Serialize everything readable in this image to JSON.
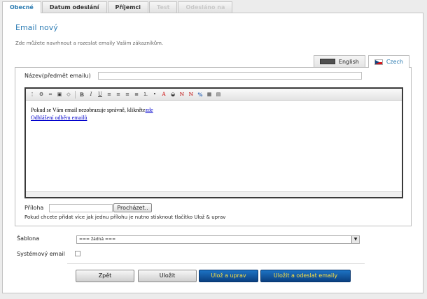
{
  "top_tabs": [
    {
      "label": "Obecné",
      "state": "active"
    },
    {
      "label": "Datum odeslání",
      "state": "normal"
    },
    {
      "label": "Příjemci",
      "state": "normal"
    },
    {
      "label": "Test",
      "state": "disabled"
    },
    {
      "label": "Odesláno na",
      "state": "disabled"
    }
  ],
  "page": {
    "title": "Email nový",
    "description": "Zde můžete navrhnout a rozeslat emaily Vašim zákazníkům."
  },
  "lang_tabs": [
    {
      "label": "English",
      "flag": "flag-uk-icon"
    },
    {
      "label": "Czech",
      "flag": "flag-cz-icon"
    }
  ],
  "form": {
    "subject_label": "Název(předmět emailu)",
    "subject_value": "",
    "editor": {
      "line1_text": "Pokud se Vám email nezobrazuje správně, klikněte",
      "line1_link": "zde",
      "line2_link": "Odhlášení odběru emailů"
    },
    "attachment_label": "Příloha",
    "browse_label": "Procházet..",
    "attachment_note": "Pokud chcete přidat více jak jednu přílohu je nutno stisknout tlačítko Ulož & uprav"
  },
  "template": {
    "label": "Šablona",
    "selected": "=== žádná ==="
  },
  "system_email": {
    "label": "Systémový email",
    "checked": false
  },
  "buttons": {
    "back": "Zpět",
    "save": "Uložit",
    "save_edit": "Ulož a uprav",
    "save_send": "Uložit a odeslat emaily"
  },
  "colors": {
    "accent": "#2e7db5",
    "primary_button": "#0a4f9c",
    "primary_button_text": "#ffe342"
  }
}
